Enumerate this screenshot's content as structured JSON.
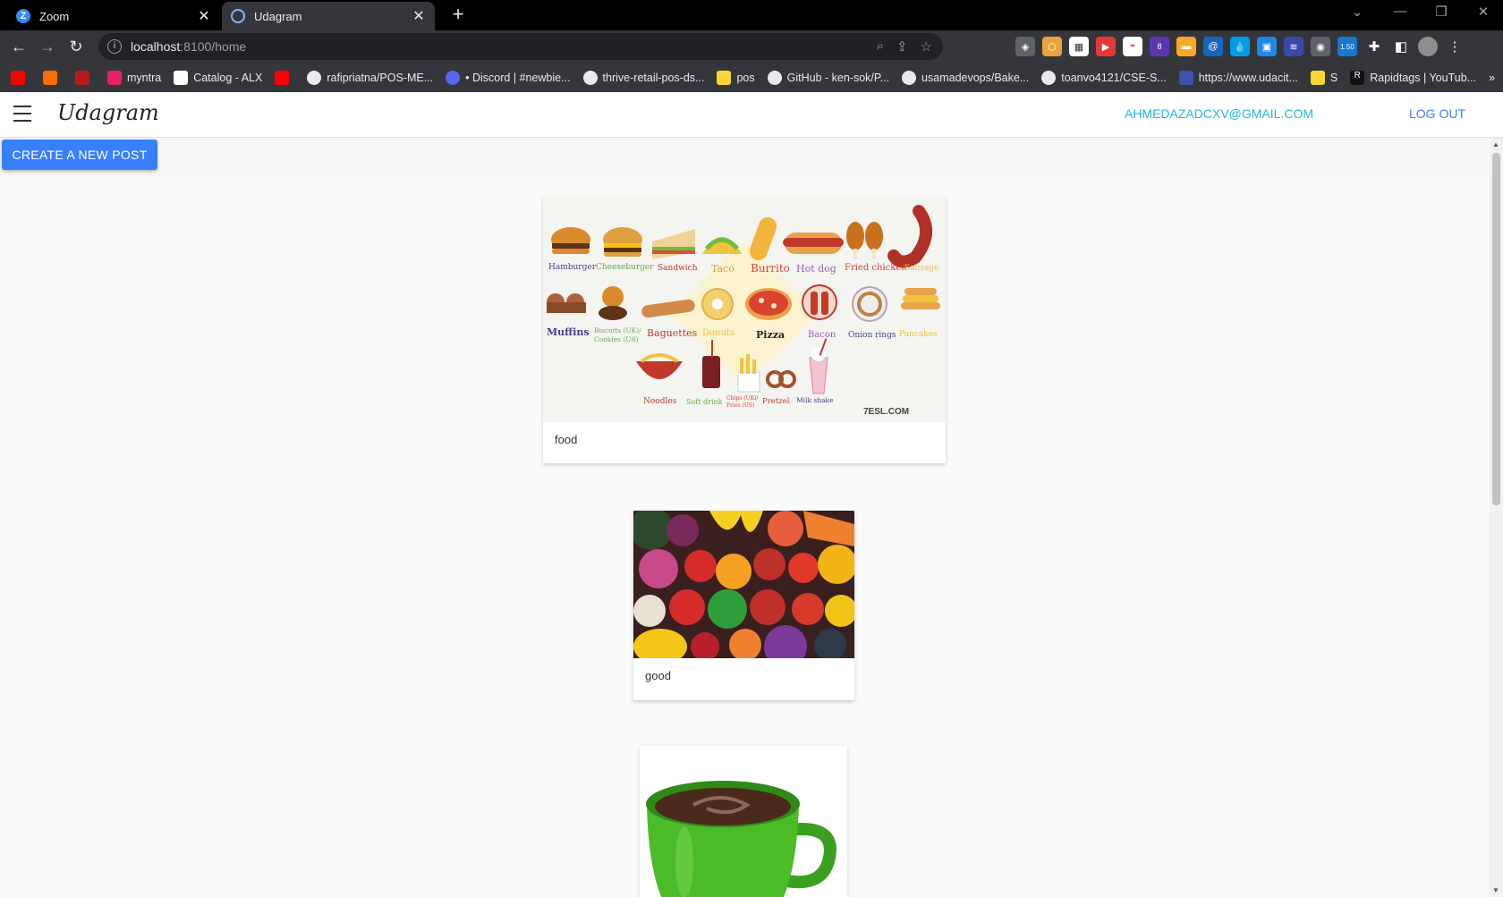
{
  "browser": {
    "tabs": [
      {
        "label": "Zoom",
        "active": false
      },
      {
        "label": "Udagram",
        "active": true
      }
    ],
    "url_host": "localhost",
    "url_path": ":8100/home",
    "bookmarks": [
      "myntra",
      "Catalog - ALX",
      "rafipriatna/POS-ME...",
      "• Discord | #newbie...",
      "thrive-retail-pos-ds...",
      "pos",
      "GitHub - ken-sok/P...",
      "usamadevops/Bake...",
      "toanvo4121/CSE-S...",
      "https://www.udacit...",
      "S",
      "Rapidtags | YouTub..."
    ],
    "extension_badges": {
      "purple": "8",
      "blue": "1.50"
    }
  },
  "app": {
    "brand": "Udagram",
    "user_email": "AHMEDAZADCXV@GMAIL.COM",
    "logout_label": "LOG OUT",
    "create_label": "CREATE A NEW POST"
  },
  "food_chart_labels": {
    "row1": [
      "Hamburger",
      "Cheeseburger",
      "Sandwich",
      "Taco",
      "Burrito",
      "Hot dog",
      "Fried chicken",
      "Sausage"
    ],
    "row2": [
      "Muffins",
      "Biscuits (UK)/ Cookies (US)",
      "Baguettes",
      "Donuts",
      "Pizza",
      "Bacon",
      "Onion rings",
      "Pancakes"
    ],
    "row3": [
      "Noodles",
      "Soft drink",
      "Chips (UK)/ Fries (US)",
      "Pretzel",
      "Milk shake"
    ],
    "watermark": "7ESL.COM"
  },
  "posts": [
    {
      "caption": "food",
      "image": "fast-food-chart"
    },
    {
      "caption": "good",
      "image": "vegetables-fruits"
    },
    {
      "caption": "",
      "image": "coffee-cup"
    }
  ],
  "colors": {
    "primary": "#3880ff",
    "secondary": "#1eb7d9"
  }
}
